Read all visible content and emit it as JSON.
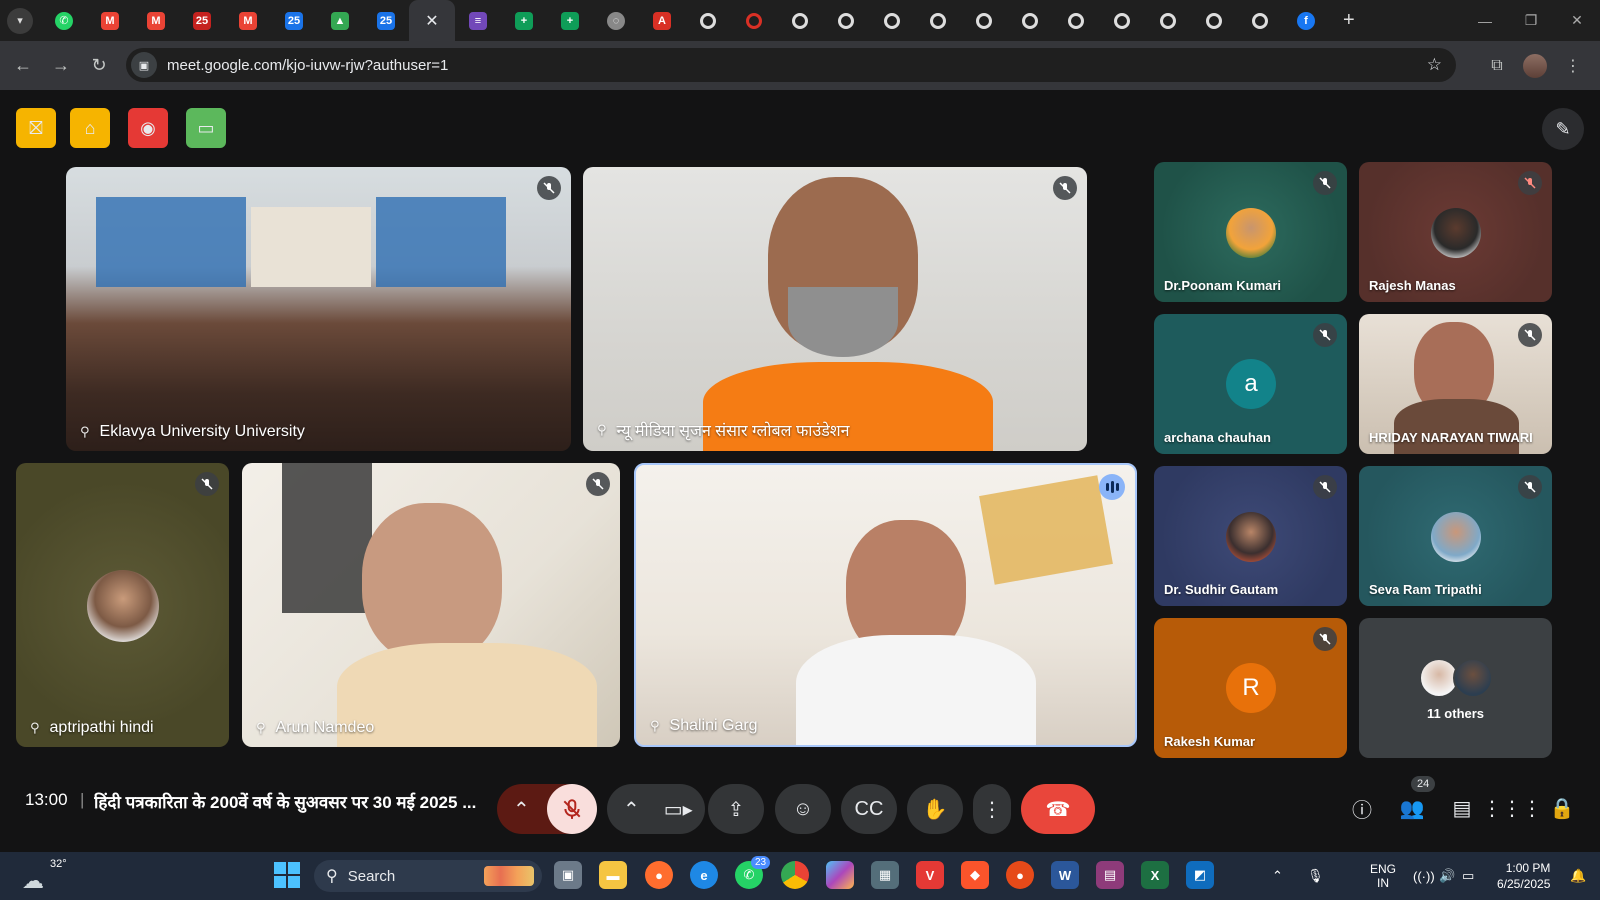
{
  "browser": {
    "tabs": [
      {
        "icon": "whatsapp-icon",
        "color": "#25D366"
      },
      {
        "icon": "gmail-icon",
        "color": "#EA4335"
      },
      {
        "icon": "gmail-icon",
        "color": "#EA4335"
      },
      {
        "icon": "calendar-icon",
        "color": "#C5221F"
      },
      {
        "icon": "gmail-icon",
        "color": "#EA4335"
      },
      {
        "icon": "calendar-icon",
        "color": "#1A73E8"
      },
      {
        "icon": "drive-icon",
        "color": "#34A853"
      },
      {
        "icon": "calendar-icon",
        "color": "#1A73E8"
      },
      {
        "icon": "meet-icon",
        "color": "#00897B"
      },
      {
        "icon": "forms-icon",
        "color": "#7248B9"
      },
      {
        "icon": "sheets-icon",
        "color": "#0F9D58"
      },
      {
        "icon": "sheets-icon",
        "color": "#0F9D58"
      },
      {
        "icon": "loading-icon",
        "color": "#888888"
      },
      {
        "icon": "pdf-icon",
        "color": "#D93025"
      },
      {
        "icon": "ring-icon",
        "color": "#DDDDDD"
      },
      {
        "icon": "ring-icon",
        "color": "#D93025"
      },
      {
        "icon": "ring-icon",
        "color": "#DDDDDD"
      },
      {
        "icon": "ring-icon",
        "color": "#DDDDDD"
      },
      {
        "icon": "ring-icon",
        "color": "#DDDDDD"
      },
      {
        "icon": "ring-icon",
        "color": "#DDDDDD"
      },
      {
        "icon": "ring-icon",
        "color": "#DDDDDD"
      },
      {
        "icon": "ring-icon",
        "color": "#DDDDDD"
      },
      {
        "icon": "ring-icon",
        "color": "#DDDDDD"
      },
      {
        "icon": "ring-icon",
        "color": "#DDDDDD"
      },
      {
        "icon": "ring-icon",
        "color": "#DDDDDD"
      },
      {
        "icon": "ring-icon",
        "color": "#DDDDDD"
      },
      {
        "icon": "ring-icon",
        "color": "#DDDDDD"
      },
      {
        "icon": "facebook-icon",
        "color": "#1877F2"
      }
    ],
    "active_tab_index": 8,
    "url": "meet.google.com/kjo-iuvw-rjw?authuser=1"
  },
  "meet": {
    "extensions": [
      {
        "icon": "no-video-icon",
        "color": "#F6B400"
      },
      {
        "icon": "building-icon",
        "color": "#F6B400"
      },
      {
        "icon": "record-icon",
        "color": "#E53935"
      },
      {
        "icon": "devices-icon",
        "color": "#5CB85C"
      }
    ],
    "tiles": {
      "eklavya": {
        "name": "Eklavya University University"
      },
      "newmedia": {
        "name": "न्यू मीडिया सृजन संसार ग्लोबल फाउंडेशन"
      },
      "aptripathi": {
        "name": "aptripathi hindi"
      },
      "arun": {
        "name": "Arun Namdeo"
      },
      "shalini": {
        "name": "Shalini Garg"
      },
      "poonam": {
        "name": "Dr.Poonam Kumari"
      },
      "rajesh": {
        "name": "Rajesh Manas"
      },
      "archana": {
        "name": "archana chauhan",
        "initial": "a"
      },
      "hriday": {
        "name": "HRIDAY NARAYAN TIWARI"
      },
      "sudhir": {
        "name": "Dr. Sudhir Gautam"
      },
      "sevaram": {
        "name": "Seva Ram Tripathi"
      },
      "rakesh": {
        "name": "Rakesh Kumar",
        "initial": "R"
      },
      "others": {
        "label": "11 others"
      }
    },
    "bottom_bar": {
      "time": "13:00",
      "separator": "|",
      "meeting_title": "हिंदी पत्रकारिता के 200वें वर्ष के सुअवसर पर 30 मई 2025 ...",
      "participant_count": "24"
    }
  },
  "taskbar": {
    "weather_temp": "32°",
    "search_placeholder": "Search",
    "whatsapp_badge": "23",
    "language_line1": "ENG",
    "language_line2": "IN",
    "clock_time": "1:00 PM",
    "clock_date": "6/25/2025"
  }
}
